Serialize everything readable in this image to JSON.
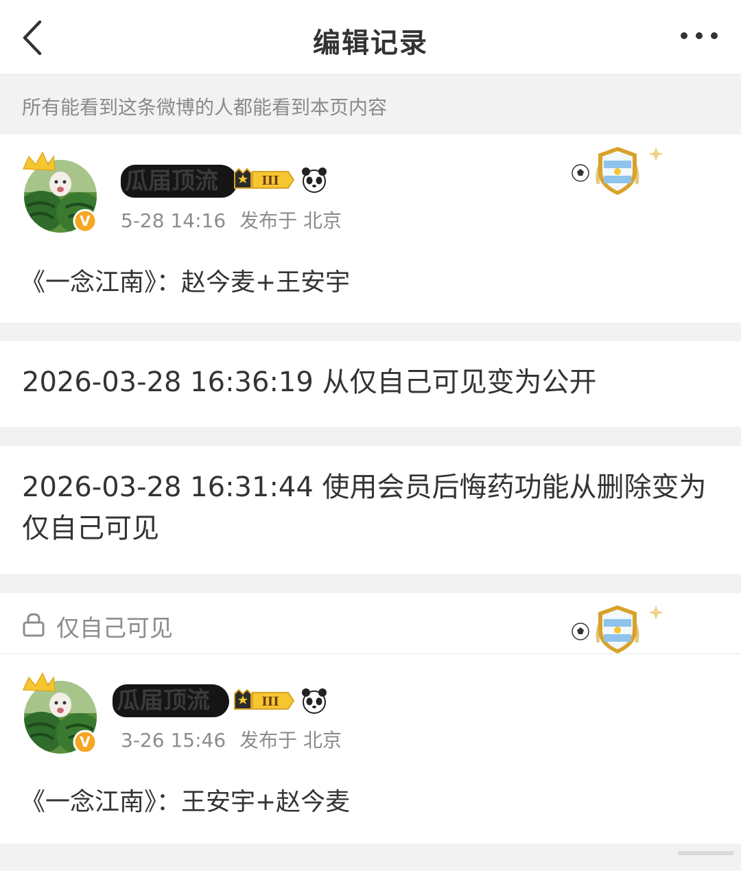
{
  "header": {
    "title": "编辑记录",
    "back_icon": "chevron-left-icon",
    "more_icon": "more-dots-icon"
  },
  "notice": {
    "text": "所有能看到这条微博的人都能看到本页内容"
  },
  "current_post": {
    "username": "瓜届顶流",
    "level_badge": "III",
    "timestamp": "5-28 14:16",
    "location": "发布于 北京",
    "content": "《一念江南》：赵今麦+王安宇",
    "decoration": "argentina-football-badge"
  },
  "records": [
    {
      "text": "2026-03-28 16:36:19 从仅自己可见变为公开"
    },
    {
      "text": "2026-03-28 16:31:44 使用会员后悔药功能从删除变为仅自己可见"
    }
  ],
  "private_section": {
    "label": "仅自己可见",
    "icon": "lock-icon",
    "decoration": "argentina-football-badge"
  },
  "old_post": {
    "username": "瓜届顶流",
    "level_badge": "III",
    "timestamp": "3-26 15:46",
    "location": "发布于 北京",
    "content": "《一念江南》：王安宇+赵今麦"
  },
  "colors": {
    "background": "#f2f2f2",
    "card": "#ffffff",
    "verified": "#f5a623",
    "gold": "#d8a22a",
    "text_secondary": "#8c8c8c"
  }
}
